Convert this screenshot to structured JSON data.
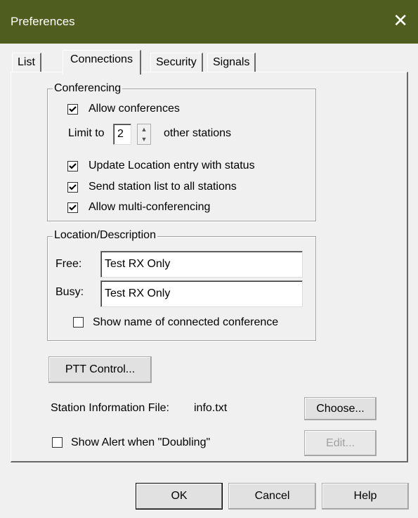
{
  "window": {
    "title": "Preferences",
    "close_glyph": "✕"
  },
  "tabs": [
    {
      "label": "List",
      "active": false
    },
    {
      "label": "Connections",
      "active": true
    },
    {
      "label": "Security",
      "active": false
    },
    {
      "label": "Signals",
      "active": false
    }
  ],
  "conferencing": {
    "legend": "Conferencing",
    "allow_conferences": {
      "label": "Allow conferences",
      "checked": true
    },
    "limit_prefix": "Limit to",
    "limit_value": "2",
    "limit_suffix": "other stations",
    "update_location": {
      "label": "Update Location entry with status",
      "checked": true
    },
    "send_station_list": {
      "label": "Send station list to all stations",
      "checked": true
    },
    "allow_multi": {
      "label": "Allow multi-conferencing",
      "checked": true
    }
  },
  "location": {
    "legend": "Location/Description",
    "free_label": "Free:",
    "free_value": "Test RX Only",
    "busy_label": "Busy:",
    "busy_value": "Test RX Only",
    "show_name": {
      "label": "Show name of connected conference",
      "checked": false
    }
  },
  "ptt_button": "PTT Control...",
  "station_info": {
    "label": "Station Information File:",
    "value": "info.txt",
    "choose": "Choose...",
    "edit": "Edit..."
  },
  "show_alert": {
    "label": "Show Alert when \"Doubling\"",
    "checked": false
  },
  "footer": {
    "ok": "OK",
    "cancel": "Cancel",
    "help": "Help"
  }
}
